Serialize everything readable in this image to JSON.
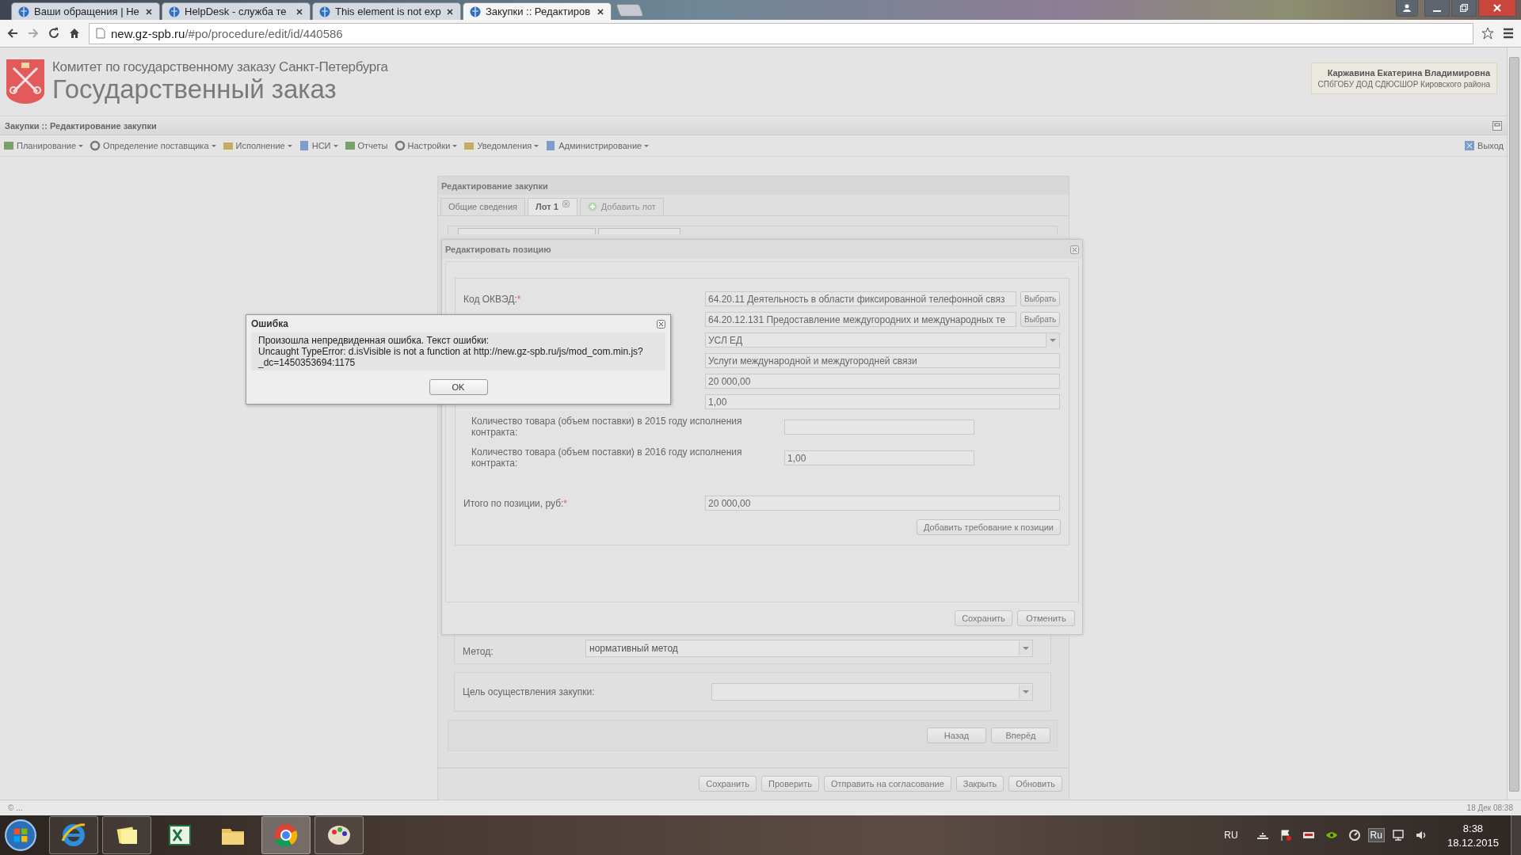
{
  "browser": {
    "tabs": [
      {
        "title": "Ваши обращения | Не",
        "selected": false
      },
      {
        "title": "HelpDesk - служба те",
        "selected": false
      },
      {
        "title": "This element is not exp",
        "selected": false
      },
      {
        "title": "Закупки :: Редактиров",
        "selected": true
      }
    ],
    "url_host": "new.gz-spb.ru",
    "url_path": "/#po/procedure/edit/id/440586"
  },
  "header": {
    "org": "Комитет по государственному заказу Санкт-Петербурга",
    "title": "Государственный заказ",
    "user_name": "Каржавина Екатерина Владимировна",
    "user_org": "СПбГОБУ ДОД СДЮСШОР Кировского района"
  },
  "page_title": "Закупки :: Редактирование закупки",
  "menu": [
    {
      "label": "Планирование",
      "dropdown": true
    },
    {
      "label": "Определение поставщика",
      "dropdown": true
    },
    {
      "label": "Исполнение",
      "dropdown": true
    },
    {
      "label": "НСИ",
      "dropdown": true
    },
    {
      "label": "Отчеты",
      "dropdown": false
    },
    {
      "label": "Настройки",
      "dropdown": true
    },
    {
      "label": "Уведомления",
      "dropdown": true
    },
    {
      "label": "Администрирование",
      "dropdown": true
    }
  ],
  "logout": "Выход",
  "panel": {
    "title": "Редактирование закупки",
    "tabs": [
      {
        "label": "Общие сведения",
        "selected": false,
        "closable": false,
        "disabled": false
      },
      {
        "label": "Лот 1",
        "selected": true,
        "closable": true,
        "disabled": false
      },
      {
        "label": "Добавить лот",
        "selected": false,
        "closable": false,
        "disabled": true
      }
    ],
    "fields": [
      {
        "label": "Метод:",
        "value": "нормативный метод"
      },
      {
        "label": "Цель осуществления закупки:"
      }
    ],
    "nav_buttons": [
      "Назад",
      "Вперёд"
    ],
    "buttons": [
      "Сохранить",
      "Проверить",
      "Отправить на согласование",
      "Закрыть",
      "Обновить"
    ]
  },
  "position_dialog": {
    "title": "Редактировать позицию",
    "rows": [
      {
        "kind": "picker",
        "label": "Код ОКВЭД:",
        "mark": "*",
        "value": "64.20.11 Деятельность в области фиксированной телефонной связ",
        "button": "Выбрать"
      },
      {
        "kind": "picker",
        "value": "64.20.12.131 Предоставление междугородних и международных те",
        "button": "Выбрать"
      },
      {
        "kind": "select",
        "value": "УСЛ ЕД"
      },
      {
        "kind": "text",
        "value": "Услуги международной и междугородней связи"
      },
      {
        "kind": "text",
        "value": "20 000,00"
      },
      {
        "kind": "text",
        "value": "1,00"
      },
      {
        "kind": "year",
        "label": "Количество товара (объем поставки) в 2015 году исполнения контракта:"
      },
      {
        "kind": "year",
        "label": "Количество товара (объем поставки) в 2016 году исполнения контракта:",
        "value": "1,00"
      },
      {
        "kind": "total",
        "label": "Итого по позиции, руб:",
        "mark": "*",
        "value": "20 000,00"
      }
    ],
    "add_button": "Добавить требование к позиции",
    "buttons": [
      "Сохранить",
      "Отменить"
    ]
  },
  "error_dialog": {
    "title": "Ошибка",
    "lines": [
      "Произошла непредвиденная ошибка. Текст ошибки:",
      "Uncaught TypeError: d.isVisible is not a function at http://new.gz-spb.ru/js/mod_com.min.js?_dc=1450353694:1175"
    ],
    "button": "OK"
  },
  "status_bar": {
    "left": "© ...",
    "right": "18 Дек 08:38"
  },
  "taskbar": {
    "apps": [
      {
        "running": true,
        "active": false
      },
      {
        "running": true,
        "active": false
      },
      {
        "running": false,
        "active": false
      },
      {
        "running": false,
        "active": false
      },
      {
        "running": true,
        "active": true
      },
      {
        "running": true,
        "active": false
      }
    ],
    "lang": "RU",
    "ime": "Ru",
    "time": "8:38",
    "date": "18.12.2015"
  }
}
